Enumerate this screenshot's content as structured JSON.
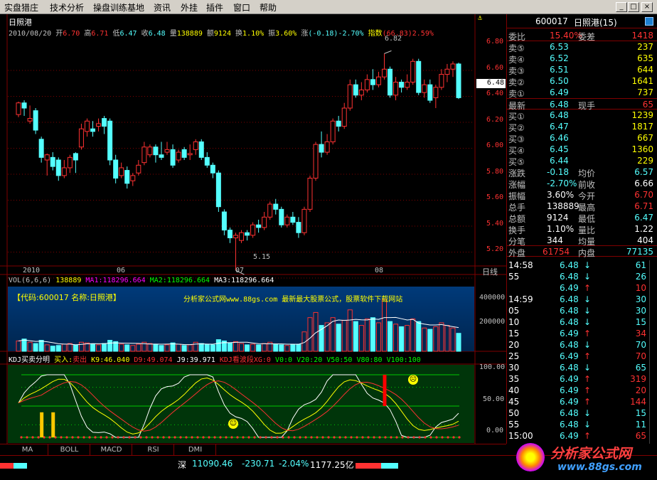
{
  "menu": [
    "实盘猎庄",
    "技术分析",
    "操盘训练基地",
    "资讯",
    "外挂",
    "插件",
    "窗口",
    "帮助"
  ],
  "stock": {
    "name": "日照港",
    "date": "2010/08/20"
  },
  "info_line": {
    "open_label": "开",
    "open": "6.70",
    "high_label": "高",
    "high": "6.71",
    "low_label": "低",
    "low": "6.47",
    "close_label": "收",
    "close": "6.48",
    "vol_label": "量",
    "vol": "138889",
    "amt_label": "额",
    "amt": "9124",
    "turn_label": "换",
    "turn": "1.10%",
    "amp_label": "振",
    "amp": "3.60%",
    "chg_label": "涨",
    "chg": "(-0.18)-2.70%",
    "idx_label": "指数",
    "idx": "(66.83)2.59%"
  },
  "price_axis": [
    "6.80",
    "6.60",
    "6.40",
    "6.20",
    "6.00",
    "5.80",
    "5.60",
    "5.40",
    "5.20"
  ],
  "current_price_tag": "6.48",
  "annotations": {
    "max": "6.82",
    "min": "5.15"
  },
  "date_axis": {
    "labels": [
      "2010",
      "06",
      "07",
      "08"
    ],
    "right": "日线"
  },
  "vol_header": {
    "vol": "VOL(6,6,6)",
    "vol_val": "138889",
    "ma1": "MA1:118296.664",
    "ma2": "MA2:118296.664",
    "ma3": "MA3:118296.664"
  },
  "vol_axis": [
    "400000",
    "200000"
  ],
  "watermark": {
    "code": "【代码:600017 名称:日照港】",
    "site": "分析家公式网www.88gs.com 最新最大股票公式，股票软件下载网站"
  },
  "kdj_header": {
    "name": "KDJ买卖分明",
    "buy_label": "买入:",
    "sell": "卖出",
    "k": "K9:46.040",
    "d": "D9:49.074",
    "j": "J9:39.971",
    "wave": "KDJ看波段XG:0",
    "v0": "V0:0",
    "v20": "V20:20",
    "v50": "V50:50",
    "v80": "V80:80",
    "v100": "V100:100"
  },
  "kdj_axis": [
    "100.00",
    "50.00",
    "0.00"
  ],
  "tabs": [
    "MA",
    "BOLL",
    "MACD",
    "RSI",
    "DMI"
  ],
  "panel": {
    "code": "600017",
    "name": "日照港(15)",
    "webi_label": "委比",
    "webi": "15.40%",
    "weicha_label": "委差",
    "weicha": "1418",
    "sells": [
      {
        "l": "卖⑤",
        "p": "6.53",
        "v": "237"
      },
      {
        "l": "卖④",
        "p": "6.52",
        "v": "635"
      },
      {
        "l": "卖③",
        "p": "6.51",
        "v": "644"
      },
      {
        "l": "卖②",
        "p": "6.50",
        "v": "1641"
      },
      {
        "l": "卖①",
        "p": "6.49",
        "v": "737"
      }
    ],
    "latest_label": "最新",
    "latest": "6.48",
    "xianshou_label": "现手",
    "xianshou": "65",
    "buys": [
      {
        "l": "买①",
        "p": "6.48",
        "v": "1239"
      },
      {
        "l": "买②",
        "p": "6.47",
        "v": "1817"
      },
      {
        "l": "买③",
        "p": "6.46",
        "v": "667"
      },
      {
        "l": "买④",
        "p": "6.45",
        "v": "1360"
      },
      {
        "l": "买⑤",
        "p": "6.44",
        "v": "229"
      }
    ],
    "stats": [
      {
        "l1": "涨跌",
        "v1": "-0.18",
        "l2": "均价",
        "v2": "6.57"
      },
      {
        "l1": "涨幅",
        "v1": "-2.70%",
        "l2": "前收",
        "v2": "6.66"
      },
      {
        "l1": "振幅",
        "v1": "3.60%",
        "l2": "今开",
        "v2": "6.70"
      },
      {
        "l1": "总手",
        "v1": "138889",
        "l2": "最高",
        "v2": "6.71"
      },
      {
        "l1": "总额",
        "v1": "9124",
        "l2": "最低",
        "v2": "6.47"
      },
      {
        "l1": "换手",
        "v1": "1.10%",
        "l2": "量比",
        "v2": "1.22"
      },
      {
        "l1": "分笔",
        "v1": "344",
        "l2": "均量",
        "v2": "404"
      }
    ],
    "outer_label": "外盘",
    "outer": "61754",
    "inner_label": "内盘",
    "inner": "77135",
    "ticks": [
      {
        "t": "14:58",
        "p": "6.48",
        "d": "↓",
        "v": "61"
      },
      {
        "t": "55",
        "p": "6.48",
        "d": "↓",
        "v": "26"
      },
      {
        "t": "",
        "p": "6.49",
        "d": "↑",
        "v": "10"
      },
      {
        "t": "14:59",
        "p": "6.48",
        "d": "↓",
        "v": "30"
      },
      {
        "t": "05",
        "p": "6.48",
        "d": "↓",
        "v": "30"
      },
      {
        "t": "10",
        "p": "6.48",
        "d": "↓",
        "v": "15"
      },
      {
        "t": "15",
        "p": "6.49",
        "d": "↑",
        "v": "34"
      },
      {
        "t": "20",
        "p": "6.48",
        "d": "↓",
        "v": "70"
      },
      {
        "t": "25",
        "p": "6.49",
        "d": "↑",
        "v": "70"
      },
      {
        "t": "30",
        "p": "6.48",
        "d": "↓",
        "v": "65"
      },
      {
        "t": "35",
        "p": "6.49",
        "d": "↑",
        "v": "319"
      },
      {
        "t": "40",
        "p": "6.49",
        "d": "↑",
        "v": "20"
      },
      {
        "t": "45",
        "p": "6.49",
        "d": "↑",
        "v": "144"
      },
      {
        "t": "50",
        "p": "6.48",
        "d": "↓",
        "v": "15"
      },
      {
        "t": "55",
        "p": "6.48",
        "d": "↓",
        "v": "11"
      },
      {
        "t": "15:00",
        "p": "6.49",
        "d": "↑",
        "v": "65"
      }
    ]
  },
  "statusbar": {
    "index_name": "深",
    "index_val": "11090.46",
    "index_chg": "-230.71",
    "index_pct": "-2.04%",
    "index_amt": "1177.25亿"
  },
  "logo": {
    "text": "分析家公式网",
    "url": "www.88gs.com"
  },
  "colors": {
    "up": "#ff3232",
    "down": "#54ffff",
    "yellow": "#ffff00",
    "grid": "#800000",
    "accent_blue": "#0050a0"
  }
}
